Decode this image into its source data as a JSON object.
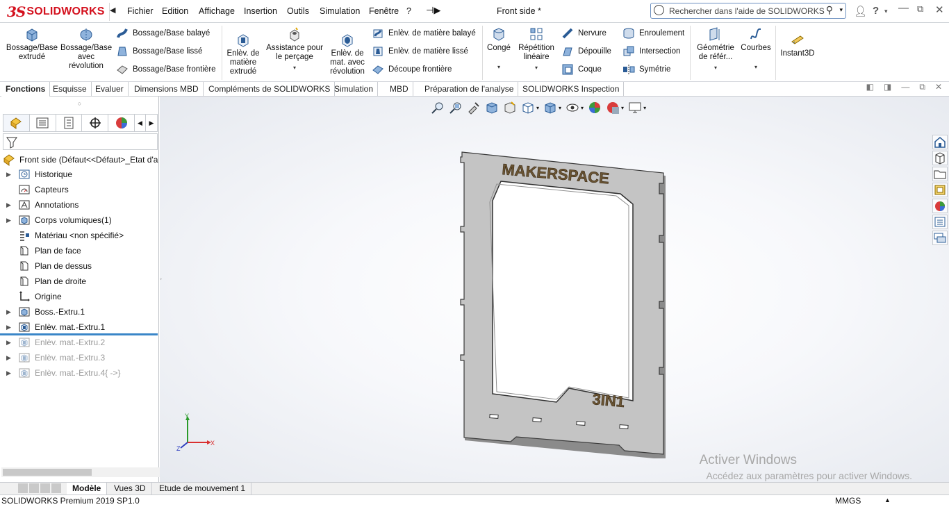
{
  "app": {
    "logo_ds": "3S",
    "logo_text": "SOLIDWORKS",
    "document_title": "Front side *"
  },
  "menu": [
    "Fichier",
    "Edition",
    "Affichage",
    "Insertion",
    "Outils",
    "Simulation",
    "Fenêtre",
    "?"
  ],
  "search": {
    "placeholder": "Rechercher dans l'aide de SOLIDWORKS"
  },
  "commands": {
    "boss_extrude": "Bossage/Base extrudé",
    "boss_revolve": "Bossage/Base avec révolution",
    "boss_sweep": "Bossage/Base balayé",
    "boss_loft": "Bossage/Base lissé",
    "boss_boundary": "Bossage/Base frontière",
    "cut_extrude": "Enlèv. de matière extrudé",
    "hole_wizard": "Assistance pour le perçage",
    "cut_revolve": "Enlèv. de mat. avec révolution",
    "cut_sweep": "Enlèv. de matière balayé",
    "cut_loft": "Enlèv. de matière lissé",
    "boundary_cut": "Découpe frontière",
    "fillet": "Congé",
    "linear_pattern": "Répétition linéaire",
    "rib": "Nervure",
    "draft": "Dépouille",
    "shell": "Coque",
    "wrap": "Enroulement",
    "intersect": "Intersection",
    "mirror": "Symétrie",
    "ref_geometry": "Géométrie de référ...",
    "curves": "Courbes",
    "instant3d": "Instant3D"
  },
  "tabs": [
    "Fonctions",
    "Esquisse",
    "Evaluer",
    "Dimensions MBD",
    "Compléments de SOLIDWORKS",
    "Simulation",
    "MBD",
    "Préparation de l'analyse",
    "SOLIDWORKS Inspection"
  ],
  "tree": {
    "root": "Front side  (Défaut<<Défaut>_Etat d'a",
    "items": [
      {
        "label": "Historique",
        "icon": "history-folder-icon",
        "expand": true,
        "dim": false
      },
      {
        "label": "Capteurs",
        "icon": "sensor-icon",
        "expand": false,
        "dim": false
      },
      {
        "label": "Annotations",
        "icon": "annotation-icon",
        "expand": true,
        "dim": false
      },
      {
        "label": "Corps volumiques(1)",
        "icon": "solid-bodies-icon",
        "expand": true,
        "dim": false
      },
      {
        "label": "Matériau <non spécifié>",
        "icon": "material-icon",
        "expand": false,
        "dim": false
      },
      {
        "label": "Plan de face",
        "icon": "plane-icon",
        "expand": false,
        "dim": false
      },
      {
        "label": "Plan de dessus",
        "icon": "plane-icon",
        "expand": false,
        "dim": false
      },
      {
        "label": "Plan de droite",
        "icon": "plane-icon",
        "expand": false,
        "dim": false
      },
      {
        "label": "Origine",
        "icon": "origin-icon",
        "expand": false,
        "dim": false
      },
      {
        "label": "Boss.-Extru.1",
        "icon": "boss-extrude-icon",
        "expand": true,
        "dim": false
      },
      {
        "label": "Enlèv. mat.-Extru.1",
        "icon": "cut-extrude-icon",
        "expand": true,
        "dim": false
      },
      {
        "label": "Enlèv. mat.-Extru.2",
        "icon": "cut-extrude-icon",
        "expand": true,
        "dim": true
      },
      {
        "label": "Enlèv. mat.-Extru.3",
        "icon": "cut-extrude-icon",
        "expand": true,
        "dim": true
      },
      {
        "label": "Enlèv. mat.-Extru.4{ ->}",
        "icon": "cut-extrude-icon",
        "expand": true,
        "dim": true
      }
    ]
  },
  "model": {
    "top_text": "MAKERSPACE",
    "bottom_text": "3IN1"
  },
  "triad": {
    "x": "X",
    "y": "Y",
    "z": "Z"
  },
  "watermark": {
    "line1": "Activer Windows",
    "line2": "Accédez aux paramètres pour activer Windows."
  },
  "bottom_tabs": [
    "Modèle",
    "Vues 3D",
    "Etude de mouvement 1"
  ],
  "status": {
    "product": "SOLIDWORKS Premium 2019 SP1.0",
    "units": "MMGS"
  },
  "colors": {
    "brand": "#d4111e",
    "selection": "#3a86c8",
    "part_face": "#c4c4c4"
  }
}
